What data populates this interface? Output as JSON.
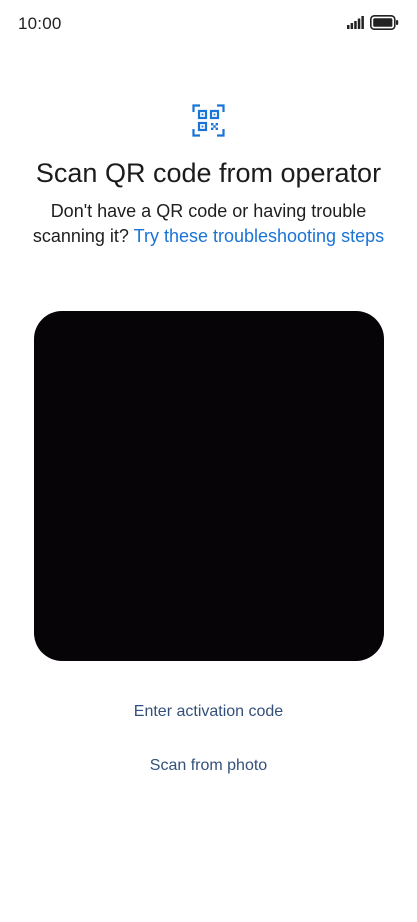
{
  "status_bar": {
    "time": "10:00",
    "icons": [
      "signal-icon",
      "battery-icon"
    ]
  },
  "header": {
    "icon": "qr-code-scan-icon",
    "title": "Scan QR code from operator",
    "subtitle_text": "Don't have a QR code or having trouble scanning it? ",
    "subtitle_link": "Try these troubleshooting steps"
  },
  "camera": {
    "background_color": "#060406"
  },
  "actions": {
    "enter_activation_code": "Enter activation code",
    "scan_from_photo": "Scan from photo"
  },
  "colors": {
    "accent": "#1a73d6",
    "action_text": "#33507a"
  }
}
